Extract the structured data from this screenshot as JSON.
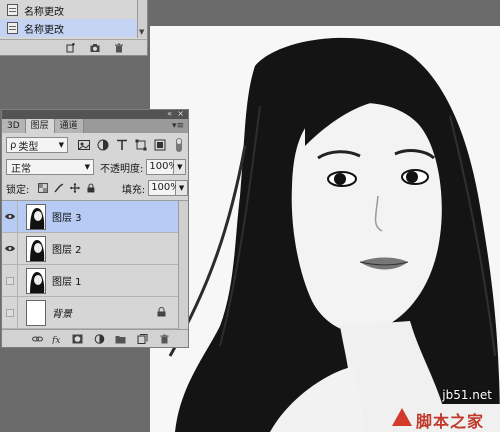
{
  "history": {
    "items": [
      {
        "label": "名称更改",
        "selected": false
      },
      {
        "label": "名称更改",
        "selected": true
      }
    ]
  },
  "layers_panel": {
    "tabs": [
      {
        "label": "3D",
        "active": false
      },
      {
        "label": "图层",
        "active": true
      },
      {
        "label": "通道",
        "active": false
      }
    ],
    "filter": {
      "value": "类型"
    },
    "blend_mode": "正常",
    "opacity_label": "不透明度:",
    "opacity_value": "100%",
    "lock_label": "锁定:",
    "fill_label": "填充:",
    "fill_value": "100%",
    "layers": [
      {
        "name": "图层 3",
        "visible": true,
        "selected": true
      },
      {
        "name": "图层 2",
        "visible": true,
        "selected": false
      },
      {
        "name": "图层 1",
        "visible": false,
        "selected": false
      },
      {
        "name": "背景",
        "visible": false,
        "selected": false,
        "locked": true
      }
    ],
    "bottom_icons": [
      "link-icon",
      "fx-icon",
      "mask-icon",
      "adjustment-icon",
      "group-icon",
      "new-layer-icon",
      "trash-icon"
    ]
  },
  "watermark": {
    "site": "jb51.net",
    "name": "脚本之家"
  },
  "colors": {
    "selection": "#b7cbf4",
    "panel_bg": "#d6d6d6",
    "workspace": "#6b6b6b",
    "brand_red": "#c0392b"
  }
}
